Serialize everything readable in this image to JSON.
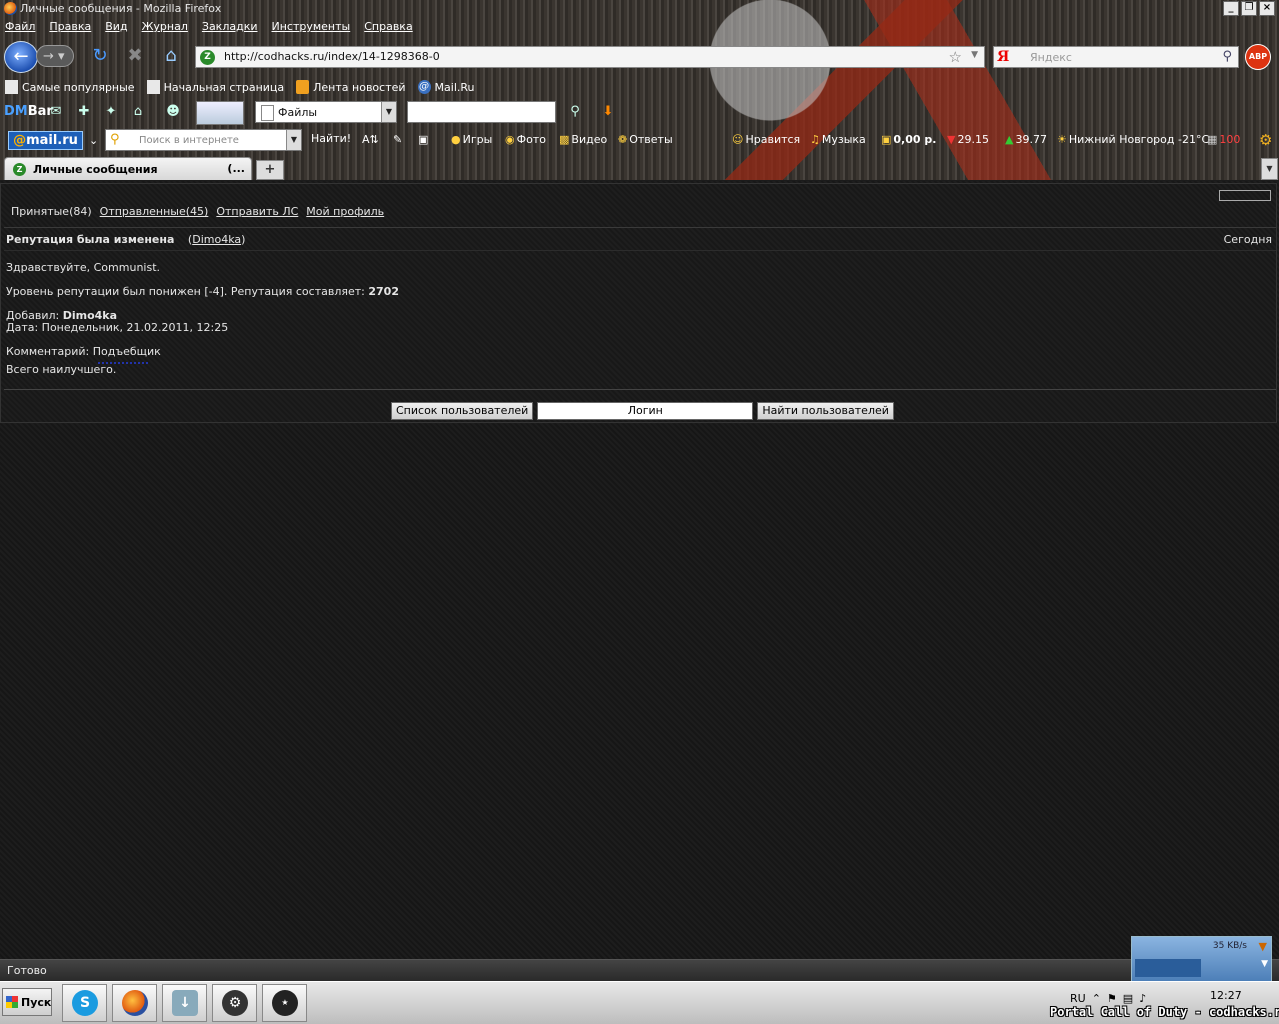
{
  "window": {
    "title": "Личные сообщения - Mozilla Firefox",
    "controls": [
      "_",
      "❐",
      "×"
    ]
  },
  "menu": [
    "Файл",
    "Правка",
    "Вид",
    "Журнал",
    "Закладки",
    "Инструменты",
    "Справка"
  ],
  "nav": {
    "url": "http://codhacks.ru/index/14-1298368-0",
    "search_placeholder": "Яндекс",
    "search_engine_logo": "Я",
    "abp_label": "ABP"
  },
  "bookmarks": [
    "Самые популярные",
    "Начальная страница",
    "Лента новостей",
    "Mail.Ru"
  ],
  "dmbar": {
    "logo_a": "DM",
    "logo_b": "Bar",
    "select_value": "Файлы"
  },
  "mailbar": {
    "logo_prefix": "@",
    "logo_text": "mail.ru",
    "search_placeholder": "Поиск в интернете",
    "find_label": "Найти!",
    "items": {
      "games": "Игры",
      "photo": "Фото",
      "video": "Видео",
      "answers": "Ответы",
      "likes": "Нравится",
      "music": "Музыка",
      "money": "0,00 р.",
      "usd": "29.15",
      "eur": "39.77",
      "weather": "Нижний Новгород -21°C",
      "counter": "100"
    }
  },
  "tab": {
    "label": "Личные сообщения",
    "close": "(...",
    "new_tab": "+"
  },
  "page": {
    "nav": {
      "received": "Принятые(84)",
      "sent": "Отправленные(45)",
      "send_pm": "Отправить ЛС",
      "my_profile": "Мой профиль"
    },
    "message": {
      "subject": "Репутация была изменена",
      "from_open": "(",
      "from_user": "Dimo4ka",
      "from_close": ")",
      "date": "Сегодня",
      "greeting": "Здравствуйте, Communist.",
      "rep_text": "Уровень репутации был понижен [-4]. Репутация составляет:",
      "rep_value": "2702",
      "added_label": "Добавил:",
      "added_user": "Dimo4ka",
      "date_line": "Дата: Понедельник, 21.02.2011, 12:25",
      "comment": "Комментарий: Подъебщик",
      "closing": "Всего наилучшего."
    },
    "users": {
      "list_button": "Список пользователей",
      "login_value": "Логин",
      "find_button": "Найти пользователей"
    }
  },
  "status": {
    "text": "Готово",
    "net_speed": "35 KB/s"
  },
  "taskbar": {
    "start": "Пуск",
    "lang": "RU",
    "time": "12:27"
  },
  "watermark": "Portal Call of Duty - codhacks.ru"
}
